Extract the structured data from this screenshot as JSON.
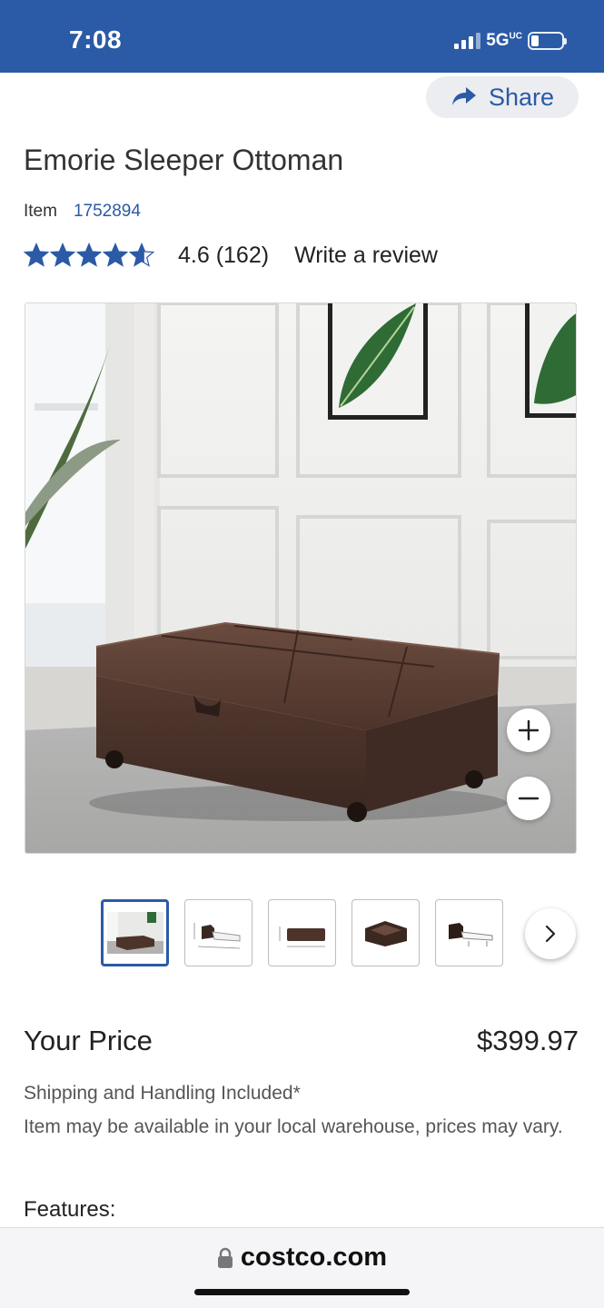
{
  "status_bar": {
    "time": "7:08",
    "network": "5G",
    "network_suffix": "UC",
    "background": "#2b5aa6"
  },
  "share": {
    "label": "Share",
    "icon": "share-arrow-icon"
  },
  "product": {
    "title": "Emorie Sleeper Ottoman",
    "item_label": "Item",
    "item_number": "1752894",
    "rating": {
      "stars": 4.6,
      "value_text": "4.6 (162)",
      "write_review": "Write a review"
    }
  },
  "gallery": {
    "main_image": "brown-leather-sleeper-ottoman-photo",
    "zoom_in_icon": "plus-icon",
    "zoom_out_icon": "minus-icon",
    "thumbnails": [
      "ottoman-room-photo",
      "ottoman-bed-dimensions",
      "ottoman-closed-dimensions",
      "ottoman-open-storage",
      "ottoman-unfolded-bed"
    ],
    "next_icon": "chevron-right-icon"
  },
  "pricing": {
    "label": "Your Price",
    "price": "$399.97",
    "shipping": "Shipping and Handling Included*",
    "availability": "Item may be available in your local warehouse, prices may vary."
  },
  "features_heading": "Features:",
  "browser": {
    "url": "costco.com",
    "lock_icon": "lock-icon"
  },
  "colors": {
    "brand": "#2b5aa6",
    "star": "#2b5aa6",
    "text": "#222222",
    "muted": "#555555"
  }
}
